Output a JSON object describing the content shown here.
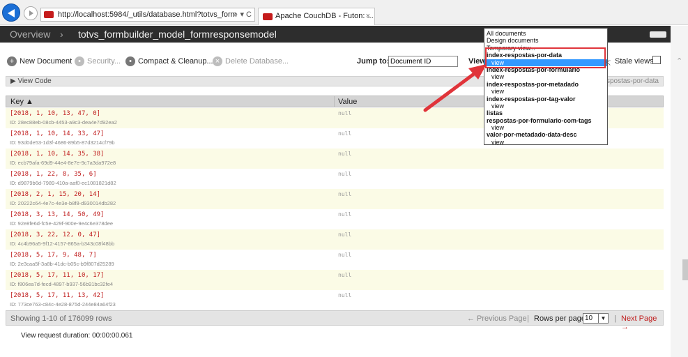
{
  "browser": {
    "url": "http://localhost:5984/_utils/database.html?totvs_form",
    "url_controls": "⌕ ▾ C",
    "tab_title": "Apache CouchDB - Futon: ...",
    "tab_close": "×"
  },
  "header": {
    "overview": "Overview",
    "separator": "›",
    "database": "totvs_formbuilder_model_formresponsemodel"
  },
  "toolbar": {
    "new_document": "New Document",
    "security": "Security...",
    "compact": "Compact & Cleanup...",
    "delete_db": "Delete Database...",
    "jump_to_label": "Jump to:",
    "jump_to_value": "Document ID",
    "view_label": "View",
    "stale_views": "Stale views"
  },
  "view_code": {
    "label": "▶ View Code",
    "right_text": "spostas-por-data"
  },
  "table": {
    "key_header": "Key ▲",
    "value_header": "Value",
    "rows": [
      {
        "key": "[2018, 1, 10, 13, 47, 0]",
        "id": "ID: 28ec88eb-08cb-4453-a9c3-dea4e7d92ea2",
        "value": "null"
      },
      {
        "key": "[2018, 1, 10, 14, 33, 47]",
        "id": "ID: 93d0de53-1d3f-4686-89b5-87d3214cf79b",
        "value": "null"
      },
      {
        "key": "[2018, 1, 10, 14, 35, 38]",
        "id": "ID: ecb79afa-69d9-44e4-8e7e-9c7a3da972e8",
        "value": "null"
      },
      {
        "key": "[2018, 1, 22, 8, 35, 6]",
        "id": "ID: d9879b6d-7989-410a-aaf0-ec1081821d82",
        "value": "null"
      },
      {
        "key": "[2018, 2, 1, 15, 20, 14]",
        "id": "ID: 20222c64-4e7c-4e3e-b8f8-d930014db282",
        "value": "null"
      },
      {
        "key": "[2018, 3, 13, 14, 50, 49]",
        "id": "ID: 92e8fe6d-fc5e-429f-900e-9e4c6e378dee",
        "value": "null"
      },
      {
        "key": "[2018, 3, 22, 12, 0, 47]",
        "id": "ID: 4c4b96a5-9f12-4157-865a-b343c08f48bb",
        "value": "null"
      },
      {
        "key": "[2018, 5, 17, 9, 48, 7]",
        "id": "ID: 2e3caa5f-3a8b-41dc-b05c-b9f807d25289",
        "value": "null"
      },
      {
        "key": "[2018, 5, 17, 11, 10, 17]",
        "id": "ID: f806ea7d-fecd-4897-b937-56b91bc32fe4",
        "value": "null"
      },
      {
        "key": "[2018, 5, 17, 11, 13, 42]",
        "id": "ID: 773ce763-c84c-4e28-875d-244e84a64f23",
        "value": "null"
      }
    ]
  },
  "footer": {
    "showing": "Showing 1-10 of 176099 rows",
    "prev_page": "← Previous Page",
    "pipe": "|",
    "rows_per_page_label": "Rows per page:",
    "rows_per_page_value": "10",
    "next_page": "Next Page →"
  },
  "duration": "View request duration:  00:00:00.061",
  "dropdown": {
    "options": [
      {
        "label": "All documents",
        "style": "plain"
      },
      {
        "label": "Design documents",
        "style": "plain"
      },
      {
        "label": "Temporary view...",
        "style": "plain"
      },
      {
        "label": "index-respostas-por-data",
        "style": "bold"
      },
      {
        "label": "view",
        "style": "selected"
      },
      {
        "label": "index-respostas-por-formulario",
        "style": "bold"
      },
      {
        "label": "view",
        "style": "indent"
      },
      {
        "label": "index-respostas-por-metadado",
        "style": "bold"
      },
      {
        "label": "view",
        "style": "indent"
      },
      {
        "label": "index-respostas-por-tag-valor",
        "style": "bold"
      },
      {
        "label": "view",
        "style": "indent"
      },
      {
        "label": "listas",
        "style": "bold"
      },
      {
        "label": "respostas-por-formulario-com-tags",
        "style": "bold"
      },
      {
        "label": "view",
        "style": "indent"
      },
      {
        "label": "valor-por-metadado-data-desc",
        "style": "bold"
      },
      {
        "label": "view",
        "style": "indent"
      }
    ]
  },
  "colors": {
    "annotation": "#e0343a",
    "selected": "#3399ff",
    "header_bg": "#2d2d2d",
    "key_text": "#c02020"
  }
}
